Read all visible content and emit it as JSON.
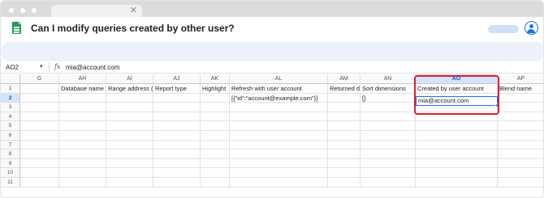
{
  "window": {
    "tab_close_glyph": "✕"
  },
  "header": {
    "title": "Can I modify queries created by other user?",
    "sheets_icon": "google-sheets-icon",
    "account_icon": "account-circle-icon"
  },
  "formula_bar": {
    "name_box": "AO2",
    "name_box_caret": "▾",
    "fx_label": "fx",
    "value": "mia@account.com"
  },
  "grid": {
    "columns": [
      {
        "label": "G"
      },
      {
        "label": "AH"
      },
      {
        "label": "AI"
      },
      {
        "label": "AJ"
      },
      {
        "label": "AK"
      },
      {
        "label": "AL"
      },
      {
        "label": "AM"
      },
      {
        "label": "AN"
      },
      {
        "label": "AO",
        "selected": true
      },
      {
        "label": "AP"
      }
    ],
    "row_numbers": [
      "1",
      "2",
      "3",
      "4",
      "5",
      "6",
      "7",
      "8",
      "9",
      "10",
      "11"
    ],
    "selected_row": "2",
    "row1": [
      "",
      "Database name",
      "Range address (",
      "Report type",
      "Highlight",
      "Refresh with user account",
      "Returned da",
      "Sort dimensions",
      "Created by user account",
      "Blend name"
    ],
    "row2": [
      "",
      "",
      "",
      "",
      "",
      "[{\"id\":\"account@example.com\"}]",
      "",
      "[]",
      "mia@account.com",
      ""
    ],
    "selected_cell_value": "mia@account.com"
  },
  "colors": {
    "accent": "#1a73e8",
    "highlight_box": "#e01e2b",
    "sheets_green": "#1f9d55"
  }
}
